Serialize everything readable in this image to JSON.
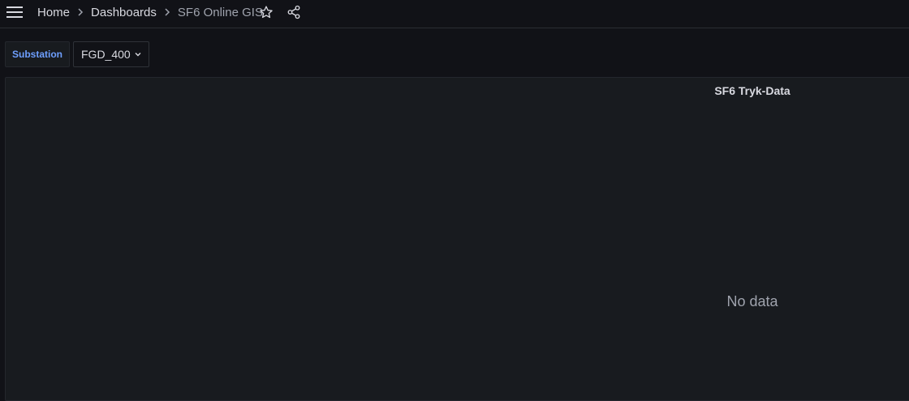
{
  "header": {
    "menu_icon": "hamburger-menu-icon",
    "breadcrumb": {
      "home": "Home",
      "dashboards": "Dashboards",
      "current": "SF6 Online GIS"
    },
    "star_icon": "star-icon",
    "share_icon": "share-icon"
  },
  "variables": {
    "label": "Substation",
    "selected_value": "FGD_400"
  },
  "panel": {
    "title": "SF6 Tryk-Data",
    "empty_message": "No data"
  },
  "colors": {
    "background": "#111217",
    "panel_background": "#181b1f",
    "variable_label": "#6e9fff",
    "text_primary": "#d8d9e0",
    "text_secondary": "#9fa3ad"
  }
}
